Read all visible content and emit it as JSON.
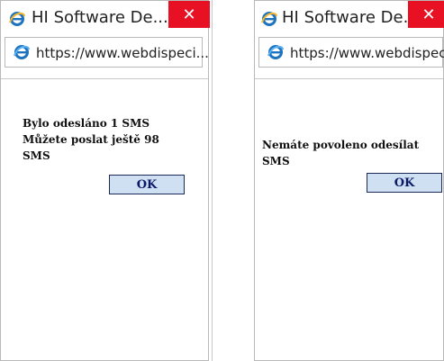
{
  "windows": [
    {
      "title": "HI Software De...",
      "close_label": "✕",
      "url": "https://www.webdispeci...",
      "message_lines": [
        "Bylo odesláno 1 SMS",
        "Můžete poslat ještě 98",
        "SMS"
      ],
      "ok_label": "OK"
    },
    {
      "title": "HI Software De...",
      "close_label": "✕",
      "url": "https://www.webdispeci...",
      "message_lines": [
        "Nemáte povoleno odesílat SMS"
      ],
      "ok_label": "OK"
    }
  ],
  "colors": {
    "close_bg": "#e81123",
    "ok_bg": "#cfe0f3",
    "ie_blue": "#1e73be"
  },
  "icons": [
    "ie-icon",
    "close-icon"
  ]
}
